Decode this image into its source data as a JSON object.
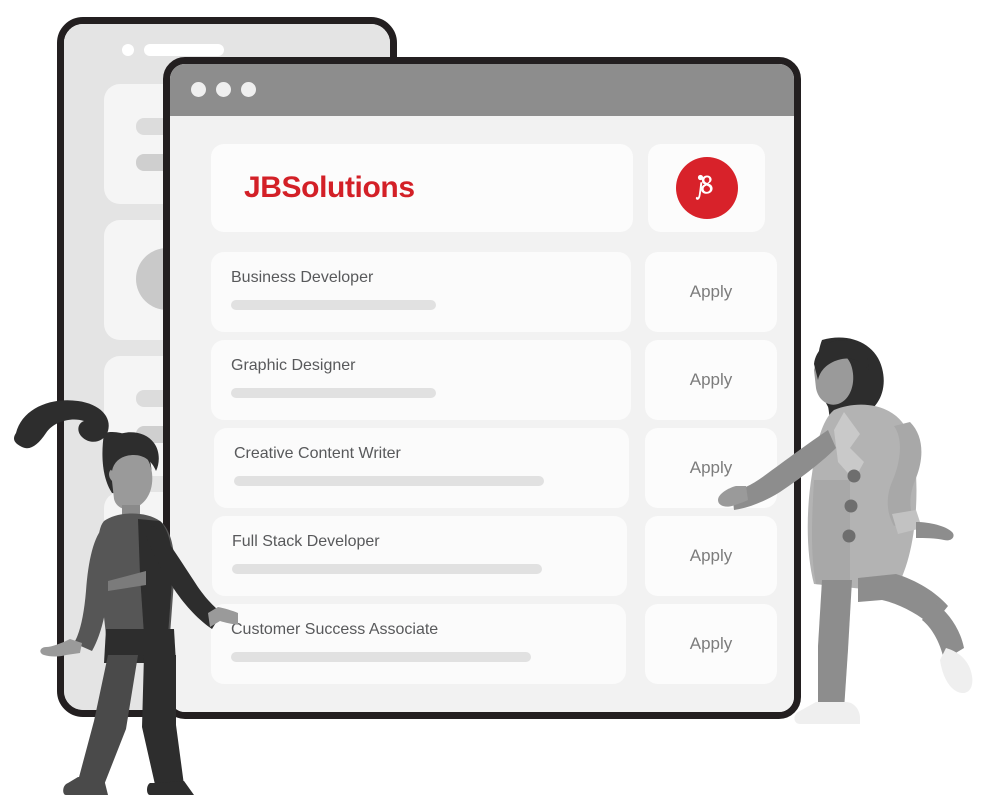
{
  "window": {
    "title_bar": {
      "dots": [
        "close-dot",
        "minimize-dot",
        "maximize-dot"
      ]
    }
  },
  "header": {
    "brand_name": "JBSolutions",
    "brand_color": "#d32027",
    "logo": {
      "name": "jb-monogram-logo",
      "letters": "jb",
      "background_color": "#d8222a",
      "foreground_color": "#ffffff"
    }
  },
  "jobs": {
    "apply_label": "Apply",
    "items": [
      {
        "title": "Business Developer",
        "line_width": 205
      },
      {
        "title": "Graphic Designer",
        "line_width": 205
      },
      {
        "title": "Creative Content Writer",
        "line_width": 310
      },
      {
        "title": "Full Stack Developer",
        "line_width": 310
      },
      {
        "title": "Customer Success Associate",
        "line_width": 300
      }
    ]
  },
  "background_window": {
    "skeleton_cards": [
      {
        "type": "two-bars"
      },
      {
        "type": "avatar-circle"
      },
      {
        "type": "two-bars"
      },
      {
        "type": "two-bars"
      }
    ]
  },
  "illustration": {
    "left_person": "walking-person-illustration",
    "right_person": "running-person-illustration"
  },
  "colors": {
    "accent_red": "#d32027",
    "title_bar_gray": "#8d8d8d",
    "page_gray": "#f2f2f2",
    "card_white": "#fbfbfb",
    "text_gray": "#58595b",
    "line_gray": "#e1e1e1",
    "frame_dark": "#231f20"
  }
}
